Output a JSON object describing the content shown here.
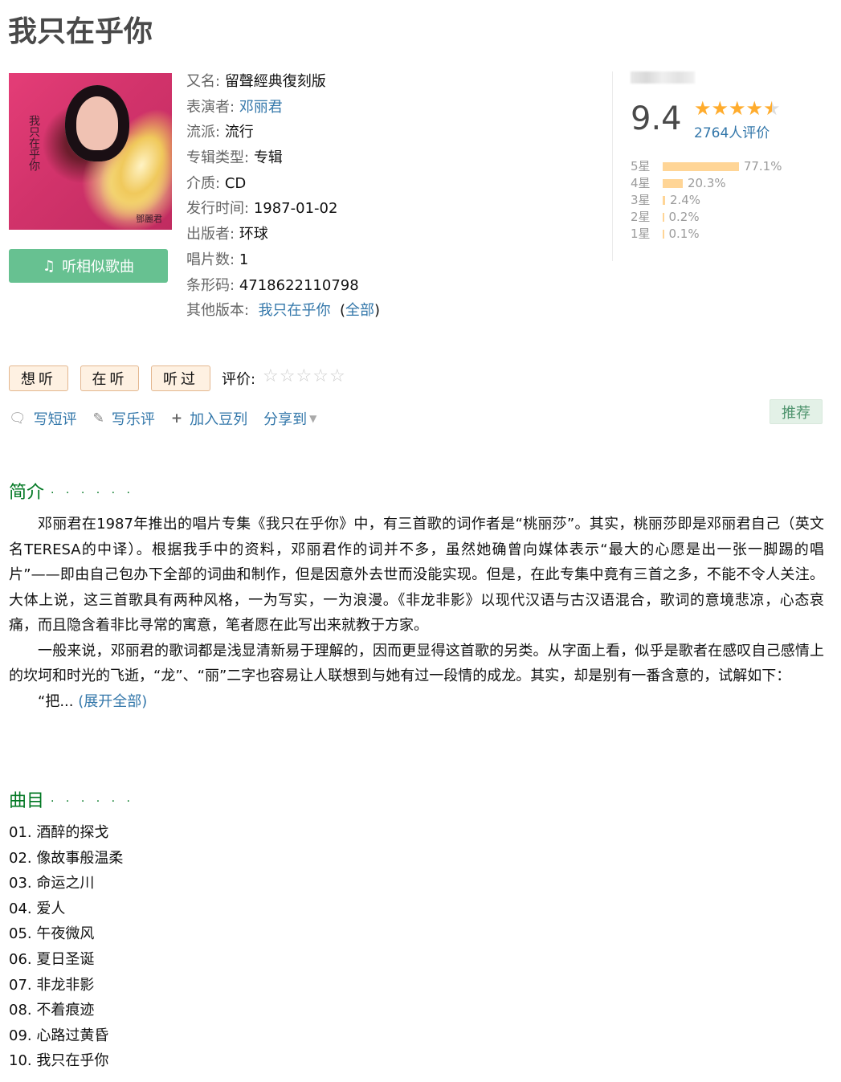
{
  "title": "我只在乎你",
  "info": {
    "alias_label": "又名:",
    "alias": "留聲經典復刻版",
    "artist_label": "表演者:",
    "artist": "邓丽君",
    "genre_label": "流派:",
    "genre": "流行",
    "type_label": "专辑类型:",
    "type": "专辑",
    "medium_label": "介质:",
    "medium": "CD",
    "release_label": "发行时间:",
    "release": "1987-01-02",
    "publisher_label": "出版者:",
    "publisher": "环球",
    "discs_label": "唱片数:",
    "discs": "1",
    "barcode_label": "条形码:",
    "barcode": "4718622110798",
    "other_label": "其他版本:",
    "other": "我只在乎你",
    "all_open": "(",
    "all": "全部",
    "all_close": ")"
  },
  "cover": {
    "calligraphy": "我只在乎你",
    "signature": "鄧麗君"
  },
  "listen_button": "听相似歌曲",
  "rating": {
    "score": "9.4",
    "stars_value": 4.5,
    "count": "2764人评价",
    "distribution": [
      {
        "label": "5星",
        "percent": "77.1%",
        "value": 77.1
      },
      {
        "label": "4星",
        "percent": "20.3%",
        "value": 20.3
      },
      {
        "label": "3星",
        "percent": "2.4%",
        "value": 2.4
      },
      {
        "label": "2星",
        "percent": "0.2%",
        "value": 0.2
      },
      {
        "label": "1星",
        "percent": "0.1%",
        "value": 0.1
      }
    ]
  },
  "actions": {
    "want": "想听",
    "doing": "在听",
    "done": "听过",
    "rate_label": "评价:"
  },
  "links": {
    "short_review": "写短评",
    "review": "写乐评",
    "add_list": "加入豆列",
    "share": "分享到",
    "recommend": "推荐"
  },
  "intro": {
    "heading": "简介",
    "dots": "· · · · · ·",
    "p1": "邓丽君在1987年推出的唱片专集《我只在乎你》中，有三首歌的词作者是“桃丽莎”。其实，桃丽莎即是邓丽君自己（英文名TERESA的中译）。根据我手中的资料，邓丽君作的词并不多，虽然她确曾向媒体表示“最大的心愿是出一张一脚踢的唱片”——即由自己包办下全部的词曲和制作，但是因意外去世而没能实现。但是，在此专集中竟有三首之多，不能不令人关注。大体上说，这三首歌具有两种风格，一为写实，一为浪漫。《非龙非影》以现代汉语与古汉语混合，歌词的意境悲凉，心态哀痛，而且隐含着非比寻常的寓意，笔者愿在此写出来就教于方家。",
    "p2": "一般来说，邓丽君的歌词都是浅显清新易于理解的，因而更显得这首歌的另类。从字面上看，似乎是歌者在感叹自己感情上的坎坷和时光的飞逝，“龙”、“丽”二字也容易让人联想到与她有过一段情的成龙。其实，却是别有一番含意的，试解如下：",
    "p3": "“把...",
    "expand": "(展开全部)"
  },
  "tracklist": {
    "heading": "曲目",
    "dots": "· · · · · ·",
    "tracks": [
      "01. 酒醉的探戈",
      "02. 像故事般温柔",
      "03. 命运之川",
      "04. 爱人",
      "05. 午夜微风",
      "06. 夏日圣诞",
      "07. 非龙非影",
      "08. 不着痕迹",
      "09. 心路过黄昏",
      "10. 我只在乎你"
    ]
  }
}
